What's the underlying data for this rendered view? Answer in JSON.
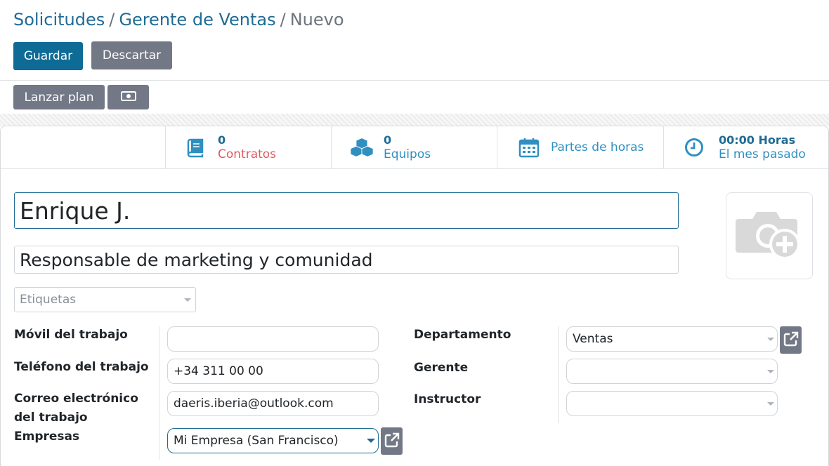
{
  "breadcrumb": {
    "items": [
      "Solicitudes",
      "Gerente de Ventas"
    ],
    "current": "Nuevo",
    "separator": "/"
  },
  "toolbar": {
    "save_label": "Guardar",
    "discard_label": "Descartar",
    "launch_plan_label": "Lanzar plan",
    "money_icon": "money-icon"
  },
  "smart_buttons": {
    "contracts": {
      "value": "0",
      "label": "Contratos",
      "icon": "book-icon"
    },
    "equipment": {
      "value": "0",
      "label": "Equipos",
      "icon": "cubes-icon"
    },
    "timesheets": {
      "label": "Partes de horas",
      "icon": "calendar-icon"
    },
    "hours": {
      "value": "00:00 Horas",
      "label": "El mes pasado",
      "icon": "clock-icon"
    }
  },
  "employee": {
    "name": "Enrique J.",
    "job_title": "Responsable de marketing y comunidad",
    "tags_placeholder": "Etiquetas"
  },
  "fields": {
    "mobile_label": "Móvil del trabajo",
    "mobile_value": "",
    "phone_label": "Teléfono del trabajo",
    "phone_value": "+34 311 00 00",
    "email_label_1": "Correo electrónico",
    "email_label_2": "del trabajo",
    "email_value": "daeris.iberia@outlook.com",
    "company_label": "Empresas",
    "company_value": "Mi Empresa (San Francisco)",
    "department_label": "Departamento",
    "department_value": "Ventas",
    "manager_label": "Gerente",
    "manager_value": "",
    "coach_label": "Instructor",
    "coach_value": ""
  },
  "colors": {
    "primary": "#0e6b95",
    "secondary": "#737887",
    "link": "#1f6b94",
    "danger_label": "#e0595f",
    "teal_icon": "#2f8fc1"
  }
}
